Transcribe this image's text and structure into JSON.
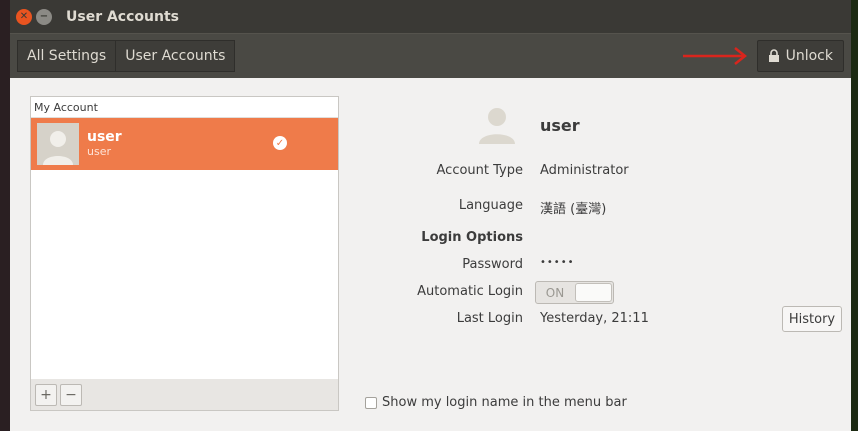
{
  "window": {
    "title": "User Accounts"
  },
  "toolbar": {
    "crumb_all_settings": "All Settings",
    "crumb_user_accounts": "User Accounts",
    "unlock_label": "Unlock"
  },
  "accounts": {
    "header": "My Account",
    "items": [
      {
        "name": "user",
        "login": "user",
        "selected": true
      }
    ],
    "add_label": "+",
    "remove_label": "−"
  },
  "details": {
    "user_name": "user",
    "account_type_label": "Account Type",
    "account_type_value": "Administrator",
    "language_label": "Language",
    "language_value": "漢語 (臺灣)",
    "login_options_label": "Login Options",
    "password_label": "Password",
    "password_value": "•••••",
    "auto_login_label": "Automatic Login",
    "auto_login_state": "ON",
    "last_login_label": "Last Login",
    "last_login_value": "Yesterday, 21:11",
    "history_label": "History",
    "show_login_name_label": "Show my login name in the menu bar"
  },
  "colors": {
    "accent": "#ef7b4a",
    "titlebar": "#3a3935",
    "toolbar": "#4a4944",
    "annotation_arrow": "#d9251d"
  },
  "icons": {
    "close": "close-icon",
    "minimize": "minimize-icon",
    "lock": "lock-icon",
    "avatar": "user-avatar-icon",
    "check": "checkmark-icon"
  }
}
